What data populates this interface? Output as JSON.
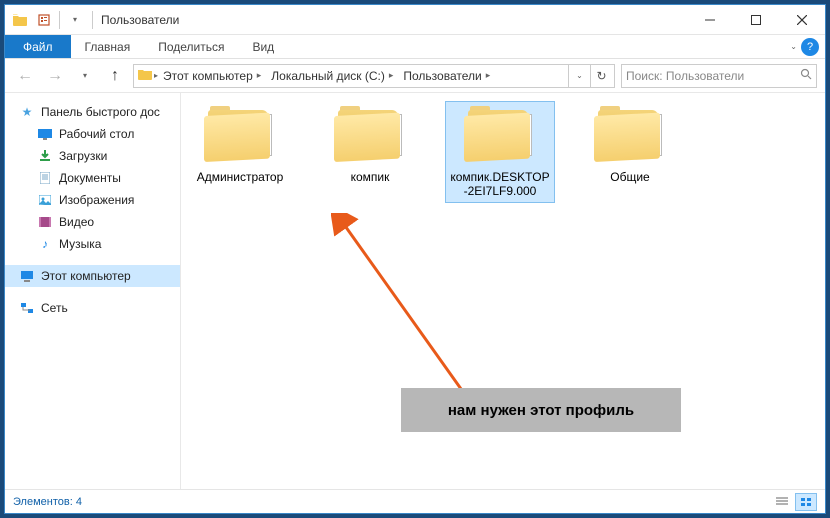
{
  "window": {
    "title": "Пользователи"
  },
  "ribbon": {
    "file": "Файл",
    "tabs": [
      "Главная",
      "Поделиться",
      "Вид"
    ]
  },
  "breadcrumb": {
    "segments": [
      "Этот компьютер",
      "Локальный диск (C:)",
      "Пользователи"
    ]
  },
  "search": {
    "placeholder": "Поиск: Пользователи"
  },
  "sidebar": {
    "quick_access": "Панель быстрого дос",
    "items": [
      {
        "label": "Рабочий стол",
        "icon": "desktop",
        "color": "#1e88e5"
      },
      {
        "label": "Загрузки",
        "icon": "downloads",
        "color": "#2e9e4a"
      },
      {
        "label": "Документы",
        "icon": "documents",
        "color": "#7aa7c7"
      },
      {
        "label": "Изображения",
        "icon": "pictures",
        "color": "#3aa0d8"
      },
      {
        "label": "Видео",
        "icon": "videos",
        "color": "#a64a8a"
      },
      {
        "label": "Музыка",
        "icon": "music",
        "color": "#1e88e5"
      }
    ],
    "this_pc": "Этот компьютер",
    "network": "Сеть"
  },
  "folders": [
    {
      "name": "Администратор",
      "selected": false
    },
    {
      "name": "компик",
      "selected": false
    },
    {
      "name": "компик.DESKTOP-2EI7LF9.000",
      "selected": true
    },
    {
      "name": "Общие",
      "selected": false
    }
  ],
  "annotation": {
    "text": "нам нужен этот профиль"
  },
  "status": {
    "text": "Элементов: 4"
  }
}
